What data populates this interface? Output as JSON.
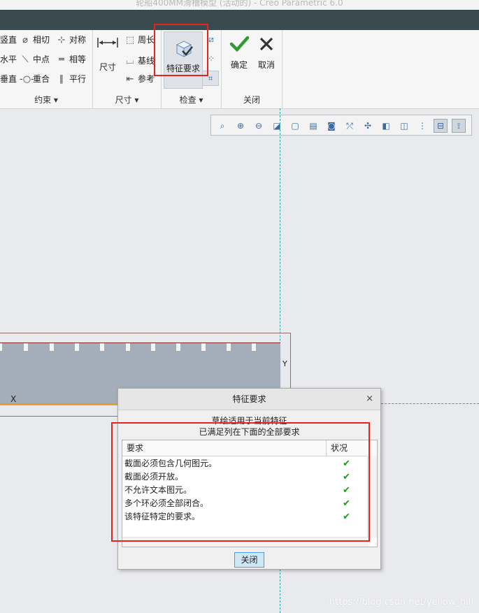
{
  "window": {
    "title": "轮船400MM滑槽模型 (活动的) - Creo Parametric 6.0"
  },
  "ribbon": {
    "constraints": {
      "items": [
        {
          "label": "竖直",
          "icon": "vertical-icon"
        },
        {
          "label": "相切",
          "icon": "tangent-icon"
        },
        {
          "label": "对称",
          "icon": "symmetric-icon"
        },
        {
          "label": "水平",
          "icon": "horizontal-icon"
        },
        {
          "label": "中点",
          "icon": "midpoint-icon"
        },
        {
          "label": "相等",
          "icon": "equal-icon"
        },
        {
          "label": "垂直",
          "icon": "perpendicular-icon"
        },
        {
          "label": "重合",
          "icon": "coincident-icon"
        },
        {
          "label": "平行",
          "icon": "parallel-icon"
        }
      ],
      "group_label": "约束 ▾"
    },
    "dimension": {
      "big_label": "尺寸",
      "items": [
        {
          "label": "周长",
          "icon": "perimeter-icon"
        },
        {
          "label": "基线",
          "icon": "baseline-icon"
        },
        {
          "label": "参考",
          "icon": "reference-icon"
        }
      ],
      "group_label": "尺寸 ▾"
    },
    "inspect": {
      "feature_requirements_label": "特征要求",
      "group_label": "检查 ▾"
    },
    "close": {
      "ok_label": "确定",
      "cancel_label": "取消",
      "group_label": "关闭"
    }
  },
  "sketch": {
    "x_axis_label": "X",
    "y_axis_label": "Y"
  },
  "dialog": {
    "title": "特征要求",
    "close_x": "×",
    "message_line1": "草绘适用于当前特征",
    "message_line2": "已满足列在下面的全部要求",
    "columns": {
      "requirement": "要求",
      "status": "状况"
    },
    "rows": [
      {
        "requirement": "截面必须包含几何图元。",
        "status": "✔"
      },
      {
        "requirement": "截面必须开放。",
        "status": "✔"
      },
      {
        "requirement": "不允许文本图元。",
        "status": "✔"
      },
      {
        "requirement": "多个环必须全部闭合。",
        "status": "✔"
      },
      {
        "requirement": "该特征特定的要求。",
        "status": "✔"
      }
    ],
    "close_button": "关闭"
  },
  "watermark": "https://blog.csdn.net/yellow_hill",
  "colors": {
    "highlight": "#e8231e",
    "ok_check": "#1a9a1a",
    "sketch_fill": "#a4aebb",
    "center_line": "#2aa7a7"
  }
}
